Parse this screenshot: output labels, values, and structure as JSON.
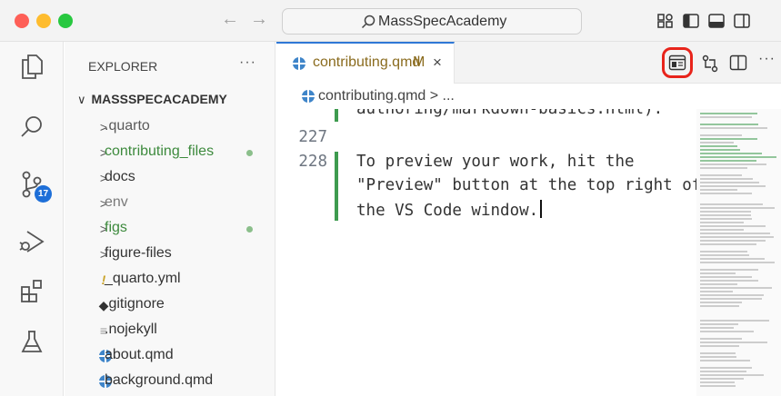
{
  "titlebar": {
    "search_text": "MassSpecAcademy",
    "nav_back_icon": "arrow-left-icon",
    "nav_forward_icon": "arrow-right-icon"
  },
  "activity_bar": {
    "items": [
      {
        "icon": "files-icon"
      },
      {
        "icon": "search-icon"
      },
      {
        "icon": "source-control-icon",
        "badge": "17"
      },
      {
        "icon": "run-debug-icon"
      },
      {
        "icon": "extensions-icon"
      },
      {
        "icon": "testing-icon"
      }
    ]
  },
  "sidebar": {
    "title": "EXPLORER",
    "more": "···",
    "root_chevron": "∨",
    "root": "MASSSPECACADEMY",
    "items": [
      {
        "label": ".quarto",
        "kind": "folder",
        "chev": ">",
        "color": "#5a5a5a",
        "dot": false
      },
      {
        "label": "contributing_files",
        "kind": "folder",
        "chev": ">",
        "color": "#3d8a3d",
        "dot": true
      },
      {
        "label": "docs",
        "kind": "folder",
        "chev": ">",
        "color": "#333333",
        "dot": false
      },
      {
        "label": "env",
        "kind": "folder",
        "chev": ">",
        "color": "#7a7a7a",
        "dot": false
      },
      {
        "label": "figs",
        "kind": "folder",
        "chev": ">",
        "color": "#3d8a3d",
        "dot": true
      },
      {
        "label": "figure-files",
        "kind": "folder",
        "chev": ">",
        "color": "#333333",
        "dot": false
      },
      {
        "label": "_quarto.yml",
        "kind": "file",
        "chev": "!",
        "color": "#333333",
        "dot": false
      },
      {
        "label": ".gitignore",
        "kind": "file",
        "chev": "◆",
        "color": "#333333",
        "dot": false
      },
      {
        "label": ".nojekyll",
        "kind": "file",
        "chev": "≡",
        "color": "#333333",
        "dot": false
      },
      {
        "label": "about.qmd",
        "kind": "file",
        "chev": "",
        "color": "#333333",
        "dot": false
      },
      {
        "label": "background.qmd",
        "kind": "file",
        "chev": "",
        "color": "#333333",
        "dot": false
      }
    ]
  },
  "tabs": [
    {
      "label": "contributing.qmd",
      "modified": "M",
      "close": "×"
    }
  ],
  "breadcrumb": "contributing.qmd > ...",
  "editor": {
    "lines": [
      {
        "num": "",
        "text": "authoring/markdown-basics.html)."
      },
      {
        "num": "227",
        "text": ""
      },
      {
        "num": "228",
        "text": "To preview your work, hit the"
      },
      {
        "num": "",
        "text": "\"Preview\" button at the top right of"
      },
      {
        "num": "",
        "text": "the VS Code window."
      }
    ]
  },
  "colors": {
    "accent": "#2f78d6",
    "highlight": "#e8241b",
    "gutter_added": "#3e9b4f"
  }
}
